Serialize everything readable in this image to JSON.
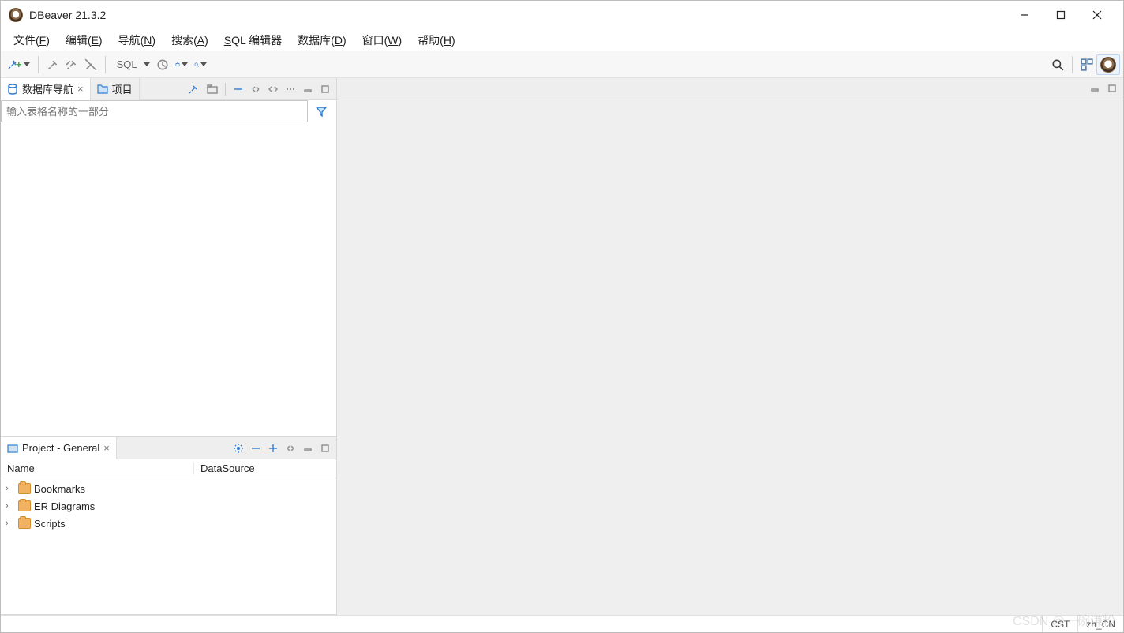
{
  "title": "DBeaver 21.3.2",
  "menu": {
    "file": {
      "label": "文件",
      "hotkey": "F"
    },
    "edit": {
      "label": "编辑",
      "hotkey": "E"
    },
    "nav": {
      "label": "导航",
      "hotkey": "N"
    },
    "search": {
      "label": "搜索",
      "hotkey": "A"
    },
    "sql": {
      "label": "SQL 编辑器"
    },
    "db": {
      "label": "数据库",
      "hotkey": "D"
    },
    "window": {
      "label": "窗口",
      "hotkey": "W"
    },
    "help": {
      "label": "帮助",
      "hotkey": "H"
    }
  },
  "toolbar": {
    "sql_label": "SQL"
  },
  "navigator": {
    "tab_db_nav": "数据库导航",
    "tab_projects": "项目",
    "filter_placeholder": "输入表格名称的一部分"
  },
  "project_view": {
    "tab_title": "Project - General",
    "col_name": "Name",
    "col_ds": "DataSource",
    "items": [
      {
        "label": "Bookmarks"
      },
      {
        "label": "ER Diagrams"
      },
      {
        "label": "Scripts"
      }
    ]
  },
  "status": {
    "tz": "CST",
    "locale": "zh_CN"
  },
  "watermark": "CSDN @一碗谦粉"
}
